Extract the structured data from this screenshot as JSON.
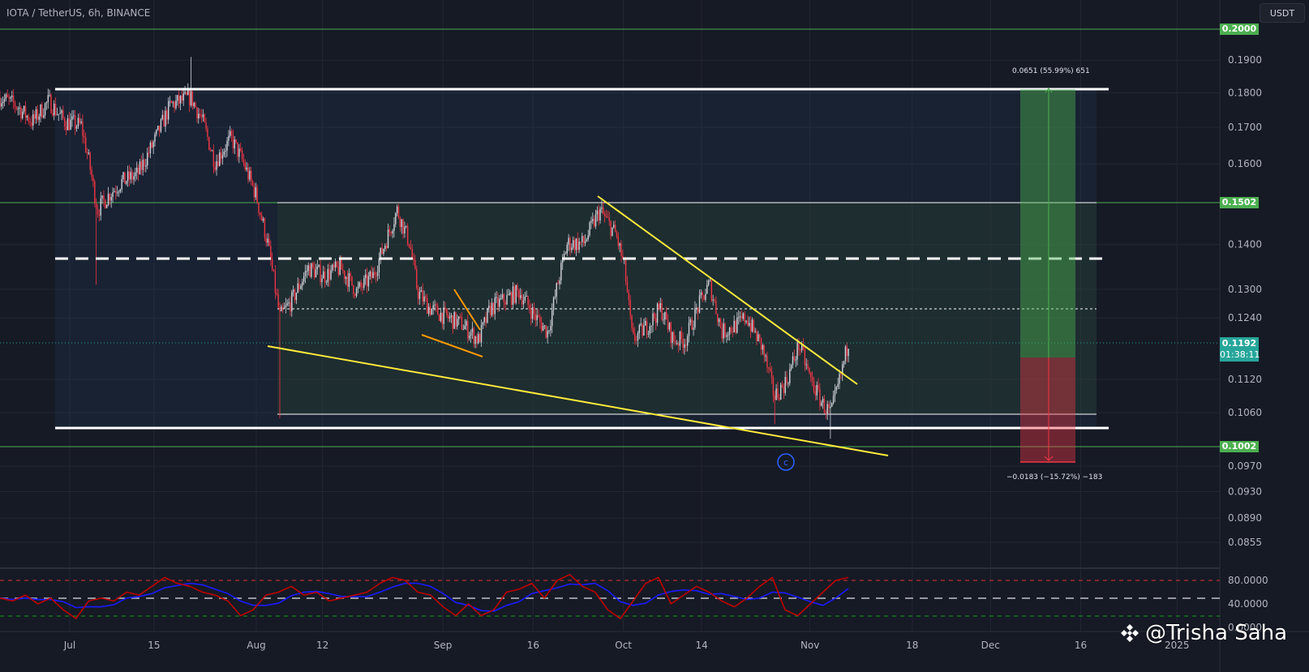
{
  "header": {
    "symbol_title": "IOTA / TetherUS, 6h, BINANCE",
    "currency_button": "USDT"
  },
  "price_badges": {
    "top": "0.2000",
    "resistance": "0.1502",
    "last_price": "0.1192",
    "countdown": "01:38:11",
    "support": "0.1002"
  },
  "position_tool": {
    "target_label": "0.0651 (55.99%) 651",
    "stop_label": "−0.0183 (−15.72%) −183"
  },
  "annotation": {
    "wave_label": "c"
  },
  "watermark": {
    "text": "@Trisha Saha",
    "logo": "binance-logo"
  },
  "colors": {
    "up": "#d1d4dc",
    "down": "#f23645",
    "accent_green": "#4caf50",
    "last_price": "#26a69a",
    "trendline": "#ffeb3b",
    "flag": "#ff9800",
    "stoch_k": "#c00000",
    "stoch_d": "#1a1aff"
  },
  "chart_data": [
    {
      "type": "candlestick",
      "title": "IOTA / TetherUS, 6h, BINANCE",
      "scale": "log",
      "ylabel": "USDT",
      "ylim": [
        0.083,
        0.205
      ],
      "x_unit": "days since Jul 1 2024",
      "xlim": [
        -11.6,
        191
      ],
      "y_ticks": [
        "0.1900",
        "0.1800",
        "0.1700",
        "0.1600",
        "0.1400",
        "0.1300",
        "0.1240",
        "0.1120",
        "0.1060",
        "0.0970",
        "0.0930",
        "0.0890",
        "0.0855"
      ],
      "x_ticks": [
        {
          "label": "Jul",
          "day": 0
        },
        {
          "label": "15",
          "day": 14
        },
        {
          "label": "Aug",
          "day": 31
        },
        {
          "label": "12",
          "day": 42
        },
        {
          "label": "Sep",
          "day": 62
        },
        {
          "label": "16",
          "day": 77
        },
        {
          "label": "Oct",
          "day": 92
        },
        {
          "label": "14",
          "day": 105
        },
        {
          "label": "Nov",
          "day": 123
        },
        {
          "label": "18",
          "day": 140
        },
        {
          "label": "Dec",
          "day": 153
        },
        {
          "label": "16",
          "day": 168
        },
        {
          "label": "2025",
          "day": 184
        }
      ],
      "price_path": [
        [
          -11.6,
          0.1787
        ],
        [
          -8.9,
          0.1763
        ],
        [
          -6.2,
          0.1716
        ],
        [
          -3.5,
          0.1775
        ],
        [
          -0.8,
          0.1716
        ],
        [
          1.9,
          0.1705
        ],
        [
          3.2,
          0.1605
        ],
        [
          4.6,
          0.1482
        ],
        [
          6.6,
          0.1522
        ],
        [
          8.6,
          0.1553
        ],
        [
          11.3,
          0.1573
        ],
        [
          14.0,
          0.1659
        ],
        [
          16.7,
          0.1763
        ],
        [
          20.1,
          0.1787
        ],
        [
          22.1,
          0.1716
        ],
        [
          24.1,
          0.1605
        ],
        [
          26.8,
          0.167
        ],
        [
          28.8,
          0.1605
        ],
        [
          30.9,
          0.1522
        ],
        [
          32.9,
          0.1403
        ],
        [
          34.9,
          0.1242
        ],
        [
          36.9,
          0.1276
        ],
        [
          39.6,
          0.1347
        ],
        [
          42.3,
          0.133
        ],
        [
          45.0,
          0.1347
        ],
        [
          47.7,
          0.1295
        ],
        [
          50.4,
          0.133
        ],
        [
          52.4,
          0.1403
        ],
        [
          54.4,
          0.1482
        ],
        [
          56.5,
          0.1403
        ],
        [
          57.8,
          0.1295
        ],
        [
          59.8,
          0.126
        ],
        [
          62.5,
          0.1242
        ],
        [
          65.2,
          0.1227
        ],
        [
          67.9,
          0.1195
        ],
        [
          69.9,
          0.126
        ],
        [
          72.0,
          0.1276
        ],
        [
          74.7,
          0.1295
        ],
        [
          77.4,
          0.1242
        ],
        [
          79.4,
          0.1211
        ],
        [
          81.4,
          0.133
        ],
        [
          82.7,
          0.1403
        ],
        [
          85.4,
          0.1403
        ],
        [
          88.1,
          0.1482
        ],
        [
          90.8,
          0.1422
        ],
        [
          92.2,
          0.1347
        ],
        [
          93.5,
          0.1195
        ],
        [
          96.2,
          0.1227
        ],
        [
          98.2,
          0.126
        ],
        [
          100.3,
          0.1195
        ],
        [
          102.3,
          0.1195
        ],
        [
          104.3,
          0.126
        ],
        [
          106.3,
          0.1312
        ],
        [
          108.4,
          0.1211
        ],
        [
          111.1,
          0.1227
        ],
        [
          112.4,
          0.1242
        ],
        [
          115.1,
          0.118
        ],
        [
          117.1,
          0.1088
        ],
        [
          119.1,
          0.1117
        ],
        [
          121.2,
          0.1187
        ],
        [
          123.2,
          0.1117
        ],
        [
          125.2,
          0.1073
        ],
        [
          126.5,
          0.1058
        ],
        [
          127.9,
          0.1117
        ],
        [
          129.4,
          0.1192
        ]
      ],
      "wick_extremes": [
        [
          20.1,
          0.191
        ],
        [
          4.4,
          0.131
        ],
        [
          34.9,
          0.105
        ],
        [
          117.1,
          0.104
        ],
        [
          126.5,
          0.1015
        ]
      ],
      "levels": {
        "range_high": 0.181,
        "range_low": 0.1045,
        "mid_dashed": 0.137,
        "inner_high": 0.1502,
        "inner_low": 0.1058,
        "inner_mid": 0.1255,
        "entry": 0.1163,
        "target": 0.1814,
        "stop": 0.098
      }
    },
    {
      "type": "line",
      "title": "Stochastic RSI",
      "ylim": [
        0,
        100
      ],
      "y_ticks": [
        "80.0000",
        "40.0000",
        "0.0000"
      ],
      "bands": {
        "upper": 80,
        "middle": 50,
        "lower": 20
      },
      "series": [
        {
          "name": "K",
          "values": [
            50,
            45,
            55,
            40,
            50,
            30,
            15,
            45,
            50,
            45,
            60,
            55,
            70,
            85,
            75,
            70,
            60,
            55,
            45,
            20,
            30,
            55,
            60,
            70,
            55,
            60,
            45,
            50,
            55,
            60,
            75,
            85,
            80,
            60,
            55,
            35,
            20,
            40,
            20,
            30,
            60,
            65,
            75,
            50,
            80,
            90,
            70,
            60,
            30,
            15,
            45,
            75,
            85,
            40,
            55,
            70,
            60,
            45,
            35,
            50,
            70,
            85,
            30,
            20,
            40,
            60,
            80,
            85
          ]
        },
        {
          "name": "D",
          "smoothing": 4
        }
      ]
    }
  ]
}
